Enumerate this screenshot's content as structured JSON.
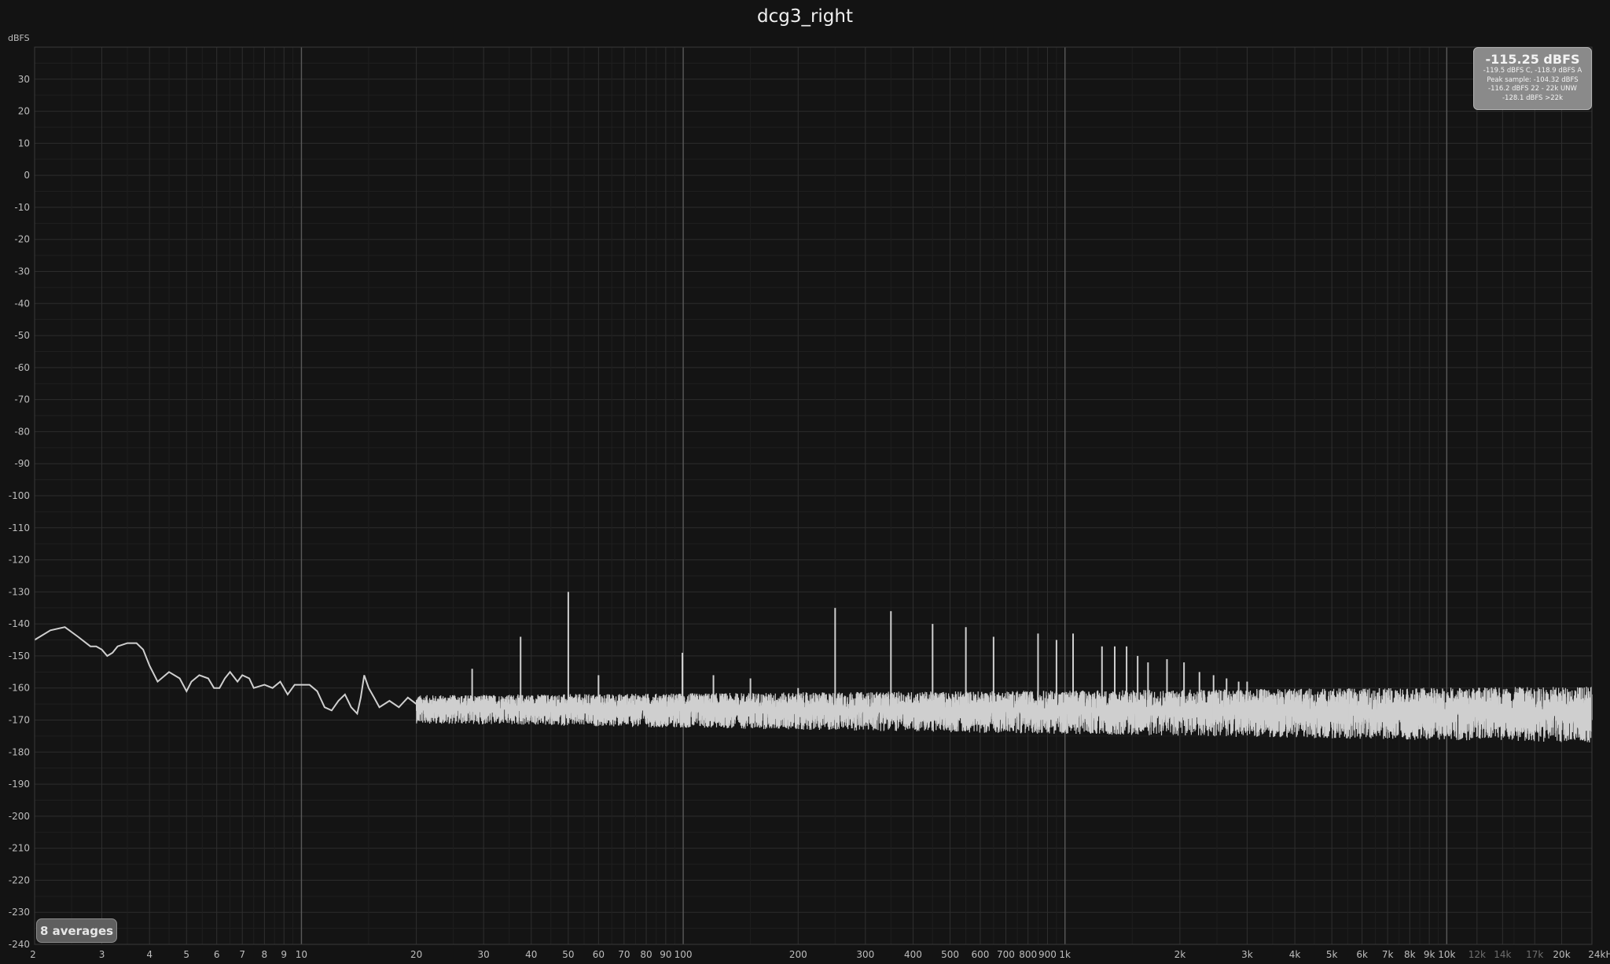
{
  "chart_data": {
    "type": "line",
    "title": "dcg3_right",
    "ylabel": "dBFS",
    "xscale": "log",
    "xlim": [
      2,
      24000
    ],
    "ylim": [
      -240,
      40
    ],
    "grid": true,
    "y_ticks": [
      30,
      20,
      10,
      0,
      -10,
      -20,
      -30,
      -40,
      -50,
      -60,
      -70,
      -80,
      -90,
      -100,
      -110,
      -120,
      -130,
      -140,
      -150,
      -160,
      -170,
      -180,
      -190,
      -200,
      -210,
      -220,
      -230,
      -240
    ],
    "x_ticks": [
      {
        "value": 2,
        "label": "2"
      },
      {
        "value": 3,
        "label": "3"
      },
      {
        "value": 4,
        "label": "4"
      },
      {
        "value": 5,
        "label": "5"
      },
      {
        "value": 6,
        "label": "6"
      },
      {
        "value": 7,
        "label": "7"
      },
      {
        "value": 8,
        "label": "8"
      },
      {
        "value": 9,
        "label": "9"
      },
      {
        "value": 10,
        "label": "10"
      },
      {
        "value": 20,
        "label": "20"
      },
      {
        "value": 30,
        "label": "30"
      },
      {
        "value": 40,
        "label": "40"
      },
      {
        "value": 50,
        "label": "50"
      },
      {
        "value": 60,
        "label": "60"
      },
      {
        "value": 70,
        "label": "70"
      },
      {
        "value": 80,
        "label": "80"
      },
      {
        "value": 90,
        "label": "90"
      },
      {
        "value": 100,
        "label": "100"
      },
      {
        "value": 200,
        "label": "200"
      },
      {
        "value": 300,
        "label": "300"
      },
      {
        "value": 400,
        "label": "400"
      },
      {
        "value": 500,
        "label": "500"
      },
      {
        "value": 600,
        "label": "600"
      },
      {
        "value": 700,
        "label": "700"
      },
      {
        "value": 800,
        "label": "800"
      },
      {
        "value": 900,
        "label": "900"
      },
      {
        "value": 1000,
        "label": "1k"
      },
      {
        "value": 2000,
        "label": "2k"
      },
      {
        "value": 3000,
        "label": "3k"
      },
      {
        "value": 4000,
        "label": "4k"
      },
      {
        "value": 5000,
        "label": "5k"
      },
      {
        "value": 6000,
        "label": "6k"
      },
      {
        "value": 7000,
        "label": "7k"
      },
      {
        "value": 8000,
        "label": "8k"
      },
      {
        "value": 9000,
        "label": "9k"
      },
      {
        "value": 10000,
        "label": "10k"
      },
      {
        "value": 12000,
        "label": "12k",
        "dim": true
      },
      {
        "value": 14000,
        "label": "14k",
        "dim": true
      },
      {
        "value": 17000,
        "label": "17k",
        "dim": true
      },
      {
        "value": 20000,
        "label": "20k"
      },
      {
        "value": 24000,
        "label": "24kHz"
      }
    ],
    "series": [
      {
        "color": "#cfcfcf",
        "low_freq_curve": [
          [
            2,
            -145
          ],
          [
            2.2,
            -142
          ],
          [
            2.4,
            -141
          ],
          [
            2.6,
            -144
          ],
          [
            2.8,
            -147
          ],
          [
            2.9,
            -147
          ],
          [
            3.0,
            -148
          ],
          [
            3.1,
            -150
          ],
          [
            3.2,
            -149
          ],
          [
            3.3,
            -147
          ],
          [
            3.5,
            -146
          ],
          [
            3.7,
            -146
          ],
          [
            3.85,
            -148
          ],
          [
            4.0,
            -153
          ],
          [
            4.2,
            -158
          ],
          [
            4.5,
            -155
          ],
          [
            4.8,
            -157
          ],
          [
            5.0,
            -161
          ],
          [
            5.15,
            -158
          ],
          [
            5.4,
            -156
          ],
          [
            5.7,
            -157
          ],
          [
            5.9,
            -160
          ],
          [
            6.1,
            -160
          ],
          [
            6.3,
            -157
          ],
          [
            6.5,
            -155
          ],
          [
            6.8,
            -158
          ],
          [
            7.0,
            -156
          ],
          [
            7.3,
            -157
          ],
          [
            7.5,
            -160
          ],
          [
            8.0,
            -159
          ],
          [
            8.4,
            -160
          ],
          [
            8.8,
            -158
          ],
          [
            9.2,
            -162
          ],
          [
            9.6,
            -159
          ],
          [
            10,
            -159
          ],
          [
            10.5,
            -159
          ],
          [
            11.0,
            -161
          ],
          [
            11.5,
            -166
          ],
          [
            12.0,
            -167
          ],
          [
            12.5,
            -164
          ],
          [
            13.0,
            -162
          ],
          [
            13.5,
            -166
          ],
          [
            14.0,
            -168
          ],
          [
            14.3,
            -163
          ],
          [
            14.6,
            -156
          ],
          [
            15.0,
            -160
          ],
          [
            15.5,
            -163
          ],
          [
            16.0,
            -166
          ],
          [
            17.0,
            -164
          ],
          [
            18.0,
            -166
          ],
          [
            19.0,
            -163
          ],
          [
            20,
            -165
          ]
        ],
        "noise_floor_db": -166,
        "noise_spread_start_db": 8,
        "noise_spread_end_db": 16,
        "peaks": [
          [
            28,
            -154
          ],
          [
            37.5,
            -144
          ],
          [
            50,
            -130
          ],
          [
            60,
            -156
          ],
          [
            99.5,
            -149
          ],
          [
            120,
            -156
          ],
          [
            150,
            -157
          ],
          [
            200,
            -160
          ],
          [
            250,
            -135
          ],
          [
            350,
            -136
          ],
          [
            450,
            -140
          ],
          [
            550,
            -141
          ],
          [
            650,
            -144
          ],
          [
            850,
            -143
          ],
          [
            950,
            -145
          ],
          [
            1050,
            -143
          ],
          [
            1250,
            -147
          ],
          [
            1350,
            -147
          ],
          [
            1450,
            -147
          ],
          [
            1550,
            -150
          ],
          [
            1650,
            -152
          ],
          [
            1850,
            -151
          ],
          [
            2050,
            -152
          ],
          [
            2250,
            -155
          ],
          [
            2450,
            -156
          ],
          [
            2650,
            -157
          ],
          [
            2850,
            -158
          ],
          [
            3000,
            -158
          ],
          [
            5500,
            -161
          ],
          [
            7500,
            -162
          ],
          [
            17000,
            -161
          ],
          [
            24000,
            -162
          ]
        ]
      }
    ]
  },
  "info_box": {
    "main": "-115.25 dBFS",
    "lines": [
      "-119.5 dBFS C, -118.9 dBFS A",
      "Peak sample: -104.32 dBFS",
      "-116.2 dBFS 22 - 22k UNW",
      "-128.1 dBFS >22k"
    ]
  },
  "averages_badge": "8 averages"
}
